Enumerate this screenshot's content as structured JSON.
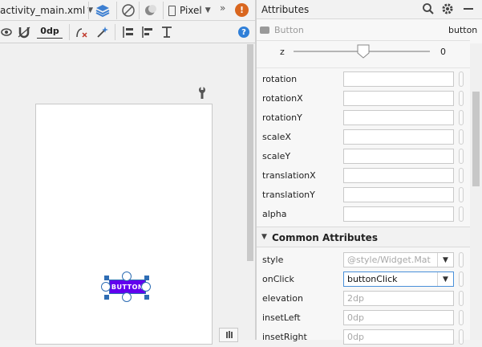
{
  "toolbar": {
    "file_tab": "activity_main.xml",
    "device": "Pixel",
    "margin_value": "0dp"
  },
  "attributes_panel": {
    "title": "Attributes",
    "component_type": "Button",
    "component_id": "button",
    "z_label": "z",
    "z_value": "0",
    "transform_rows": [
      {
        "label": "rotation",
        "value": ""
      },
      {
        "label": "rotationX",
        "value": ""
      },
      {
        "label": "rotationY",
        "value": ""
      },
      {
        "label": "scaleX",
        "value": ""
      },
      {
        "label": "scaleY",
        "value": ""
      },
      {
        "label": "translationX",
        "value": ""
      },
      {
        "label": "translationY",
        "value": ""
      },
      {
        "label": "alpha",
        "value": ""
      }
    ],
    "section_title": "Common Attributes",
    "common_rows": [
      {
        "label": "style",
        "value": "@style/Widget.Mat",
        "placeholder": true,
        "dropdown": true
      },
      {
        "label": "onClick",
        "value": "buttonClick",
        "placeholder": false,
        "dropdown": true
      },
      {
        "label": "elevation",
        "value": "2dp",
        "placeholder": true,
        "dropdown": false
      },
      {
        "label": "insetLeft",
        "value": "0dp",
        "placeholder": true,
        "dropdown": false
      },
      {
        "label": "insetRight",
        "value": "0dp",
        "placeholder": true,
        "dropdown": false
      }
    ]
  },
  "design": {
    "button_text": "BUTTON",
    "button_color": "#6200ee"
  },
  "colors": {
    "accent": "#4a90d9",
    "selection": "#2e6db4",
    "warning": "#d9661f",
    "help": "#2f7fd8"
  }
}
